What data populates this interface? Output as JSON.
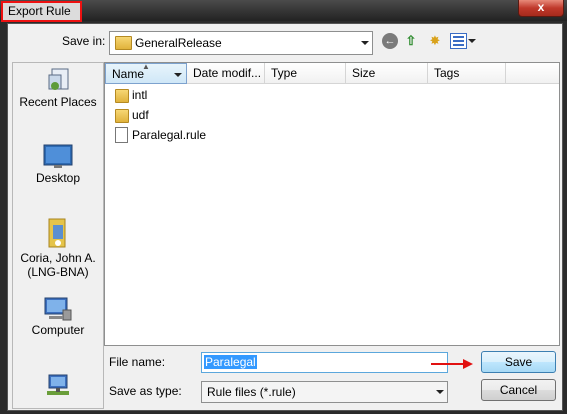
{
  "window": {
    "title": "Export Rule",
    "close_label": "x"
  },
  "toolbar": {
    "savein_label": "Save in:",
    "savein_value": "GeneralRelease"
  },
  "places": [
    {
      "label": "Recent Places",
      "icon": "recent-places-icon"
    },
    {
      "label": "Desktop",
      "icon": "desktop-icon"
    },
    {
      "label": "Coria, John A.\n(LNG-BNA)",
      "icon": "user-folder-icon"
    },
    {
      "label": "Computer",
      "icon": "computer-icon"
    },
    {
      "label": "",
      "icon": "network-icon"
    }
  ],
  "columns": [
    "Name",
    "Date modif...",
    "Type",
    "Size",
    "Tags"
  ],
  "files": [
    {
      "name": "intl",
      "kind": "folder"
    },
    {
      "name": "udf",
      "kind": "folder"
    },
    {
      "name": "Paralegal.rule",
      "kind": "file"
    }
  ],
  "form": {
    "filename_label": "File name:",
    "filename_value": "Paralegal",
    "savetype_label": "Save as type:",
    "savetype_value": "Rule files (*.rule)",
    "save_label": "Save",
    "cancel_label": "Cancel"
  },
  "colors": {
    "annotation_red": "#e11111",
    "selection_blue": "#3399ff"
  }
}
